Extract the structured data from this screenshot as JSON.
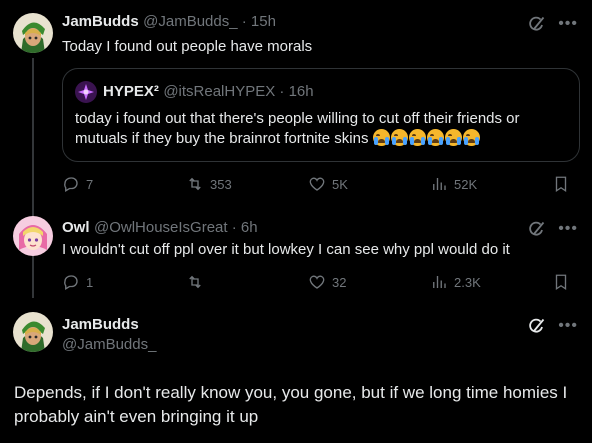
{
  "tweet1": {
    "name": "JamBudds",
    "handle": "@JamBudds_",
    "time": " · 15h",
    "text": "Today I found out people have morals",
    "quote": {
      "name": "HYPEX²",
      "handle": "@itsRealHYPEX",
      "time": " · 16h",
      "text": "today i found out that there's people willing to cut off their friends or mutuals if they buy the brainrot fortnite skins",
      "emoji_count": "6"
    },
    "stats": {
      "replies": "7",
      "retweets": "353",
      "likes": "5K",
      "views": "52K"
    }
  },
  "tweet2": {
    "name": "Owl",
    "handle": "@OwlHouseIsGreat",
    "time": " · 6h",
    "text": "I wouldn't cut off ppl over it but lowkey I can see why ppl would do it",
    "stats": {
      "replies": "1",
      "retweets": "",
      "likes": "32",
      "views": "2.3K"
    }
  },
  "tweet3": {
    "name": "JamBudds",
    "handle": "@JamBudds_",
    "text": "Depends, if I don't really know you, you gone, but if we long time homies I probably ain't even bringing it up"
  },
  "icons": [
    "grok-icon",
    "more-icon",
    "reply-icon",
    "retweet-icon",
    "like-icon",
    "views-icon",
    "bookmark-icon"
  ],
  "colors": {
    "background": "#000000",
    "text": "#e7e9ea",
    "muted": "#71767b",
    "border": "#2f3336"
  }
}
